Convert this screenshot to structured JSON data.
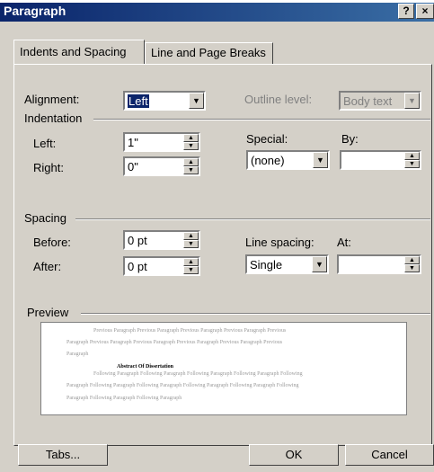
{
  "window": {
    "title": "Paragraph",
    "help_glyph": "?",
    "close_glyph": "×"
  },
  "tabs": [
    {
      "label": "Indents and Spacing",
      "active": true
    },
    {
      "label": "Line and Page Breaks",
      "active": false
    }
  ],
  "general": {
    "alignment_label": "Alignment:",
    "alignment_value": "Left",
    "outline_label": "Outline level:",
    "outline_value": "Body text"
  },
  "indentation": {
    "group_label": "Indentation",
    "left_label": "Left:",
    "left_value": "1\"",
    "right_label": "Right:",
    "right_value": "0\"",
    "special_label": "Special:",
    "special_value": "(none)",
    "by_label": "By:",
    "by_value": ""
  },
  "spacing": {
    "group_label": "Spacing",
    "before_label": "Before:",
    "before_value": "0 pt",
    "after_label": "After:",
    "after_value": "0 pt",
    "line_spacing_label": "Line spacing:",
    "line_spacing_value": "Single",
    "at_label": "At:",
    "at_value": ""
  },
  "preview": {
    "group_label": "Preview",
    "lines": [
      "Previous Paragraph Previous Paragraph Previous Paragraph Previous Paragraph Previous",
      "Paragraph Previous Paragraph Previous Paragraph Previous Paragraph Previous Paragraph Previous",
      "Paragraph",
      "Abstract Of Dissertation",
      "Following Paragraph Following Paragraph Following Paragraph Following Paragraph Following",
      "Paragraph Following Paragraph Following Paragraph Following Paragraph Following Paragraph Following",
      "Paragraph Following Paragraph Following Paragraph"
    ]
  },
  "buttons": {
    "tabs_label": "Tabs...",
    "ok_label": "OK",
    "cancel_label": "Cancel"
  },
  "icons": {
    "dropdown": "chevron-down-icon",
    "spin": "spin-arrows-icon"
  },
  "colors": {
    "title_bar": "#0a246a",
    "dialog_bg": "#d4d0c8",
    "selection": "#0a246a"
  }
}
